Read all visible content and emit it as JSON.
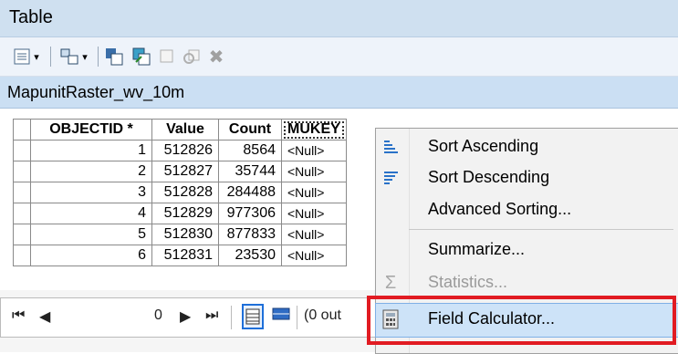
{
  "window": {
    "title": "Table"
  },
  "table": {
    "name": "MapunitRaster_wv_10m",
    "columns": [
      "OBJECTID *",
      "Value",
      "Count",
      "MUKEY"
    ],
    "rows": [
      {
        "objectid": "1",
        "value": "512826",
        "count": "8564",
        "mukey": "<Null>"
      },
      {
        "objectid": "2",
        "value": "512827",
        "count": "35744",
        "mukey": "<Null>"
      },
      {
        "objectid": "3",
        "value": "512828",
        "count": "284488",
        "mukey": "<Null>"
      },
      {
        "objectid": "4",
        "value": "512829",
        "count": "977306",
        "mukey": "<Null>"
      },
      {
        "objectid": "5",
        "value": "512830",
        "count": "877833",
        "mukey": "<Null>"
      },
      {
        "objectid": "6",
        "value": "512831",
        "count": "23530",
        "mukey": "<Null>"
      }
    ]
  },
  "toolbar": {
    "icons": [
      "table-options-icon",
      "related-tables-icon",
      "select-by-attributes-icon",
      "switch-selection-icon",
      "clear-selection-icon",
      "zoom-to-selected-icon",
      "delete-selected-icon"
    ]
  },
  "navigation": {
    "record": "0",
    "selection_status": "(0 out"
  },
  "context_menu": {
    "items": [
      {
        "label": "Sort Ascending",
        "icon": "sort-ascending-icon",
        "enabled": true
      },
      {
        "label": "Sort Descending",
        "icon": "sort-descending-icon",
        "enabled": true
      },
      {
        "label": "Advanced Sorting...",
        "icon": "",
        "enabled": true
      },
      {
        "label": "Summarize...",
        "icon": "",
        "enabled": true
      },
      {
        "label": "Statistics...",
        "icon": "sigma-icon",
        "enabled": false
      },
      {
        "label": "Field Calculator...",
        "icon": "calculator-icon",
        "enabled": true,
        "highlighted": true
      }
    ]
  },
  "colors": {
    "highlight_box": "#e11b22",
    "menu_hover": "#cde3f8",
    "title_bar": "#cfe0f0"
  }
}
